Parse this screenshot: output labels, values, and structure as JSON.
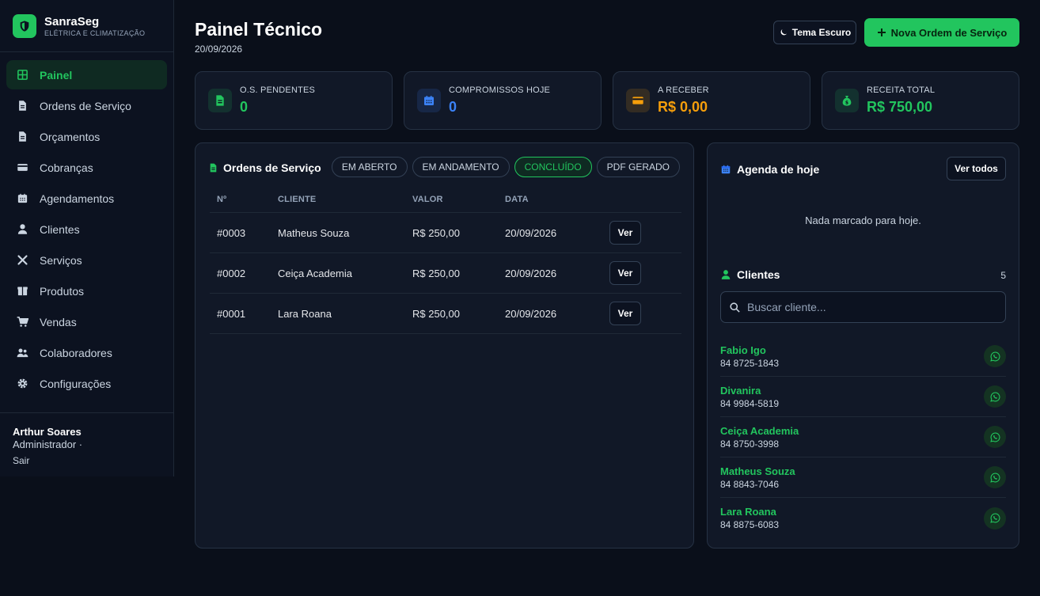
{
  "brand": {
    "name": "SanraSeg",
    "subtitle": "ELÉTRICA E CLIMATIZAÇÃO"
  },
  "nav": [
    {
      "label": "Painel",
      "icon": "grid-icon",
      "active": true
    },
    {
      "label": "Ordens de Serviço",
      "icon": "document-icon"
    },
    {
      "label": "Orçamentos",
      "icon": "document-icon"
    },
    {
      "label": "Cobranças",
      "icon": "credit-card-icon"
    },
    {
      "label": "Agendamentos",
      "icon": "calendar-icon"
    },
    {
      "label": "Clientes",
      "icon": "user-icon"
    },
    {
      "label": "Serviços",
      "icon": "tools-icon"
    },
    {
      "label": "Produtos",
      "icon": "box-icon"
    },
    {
      "label": "Vendas",
      "icon": "cart-icon"
    },
    {
      "label": "Colaboradores",
      "icon": "users-icon"
    },
    {
      "label": "Configurações",
      "icon": "gear-icon"
    }
  ],
  "user": {
    "name": "Arthur Soares",
    "role": "Administrador ·",
    "logout": "Sair"
  },
  "header": {
    "title": "Painel Técnico",
    "date": "20/09/2026",
    "theme_label": "Tema Escuro",
    "new_label": "Nova Ordem de Serviço"
  },
  "stats": [
    {
      "label": "O.S. PENDENTES",
      "value": "0",
      "color": "#22c55e",
      "icon": "document-icon"
    },
    {
      "label": "COMPROMISSOS HOJE",
      "value": "0",
      "color": "#3b82f6",
      "icon": "calendar-icon"
    },
    {
      "label": "A RECEBER",
      "value": "R$ 0,00",
      "color": "#f59e0b",
      "icon": "credit-card-icon"
    },
    {
      "label": "RECEITA TOTAL",
      "value": "R$ 750,00",
      "color": "#22c55e",
      "icon": "money-bag-icon"
    }
  ],
  "orders": {
    "title": "Ordens de Serviço",
    "filters": [
      {
        "label": "EM ABERTO"
      },
      {
        "label": "EM ANDAMENTO"
      },
      {
        "label": "CONCLUÍDO",
        "active": true
      },
      {
        "label": "PDF GERADO"
      }
    ],
    "columns": [
      "Nº",
      "CLIENTE",
      "VALOR",
      "DATA"
    ],
    "rows": [
      {
        "num": "#0003",
        "client": "Matheus Souza",
        "value": "R$ 250,00",
        "date": "20/09/2026",
        "action": "Ver"
      },
      {
        "num": "#0002",
        "client": "Ceiça Academia",
        "value": "R$ 250,00",
        "date": "20/09/2026",
        "action": "Ver"
      },
      {
        "num": "#0001",
        "client": "Lara Roana",
        "value": "R$ 250,00",
        "date": "20/09/2026",
        "action": "Ver"
      }
    ]
  },
  "agenda": {
    "title": "Agenda de hoje",
    "view_all": "Ver todos",
    "empty": "Nada marcado para hoje."
  },
  "clients": {
    "title": "Clientes",
    "count": "5",
    "search_placeholder": "Buscar cliente...",
    "items": [
      {
        "name": "Fabio Igo",
        "phone": "84 8725-1843"
      },
      {
        "name": "Divanira",
        "phone": "84 9984-5819"
      },
      {
        "name": "Ceiça Academia",
        "phone": "84 8750-3998"
      },
      {
        "name": "Matheus Souza",
        "phone": "84 8843-7046"
      },
      {
        "name": "Lara Roana",
        "phone": "84 8875-6083"
      }
    ]
  }
}
